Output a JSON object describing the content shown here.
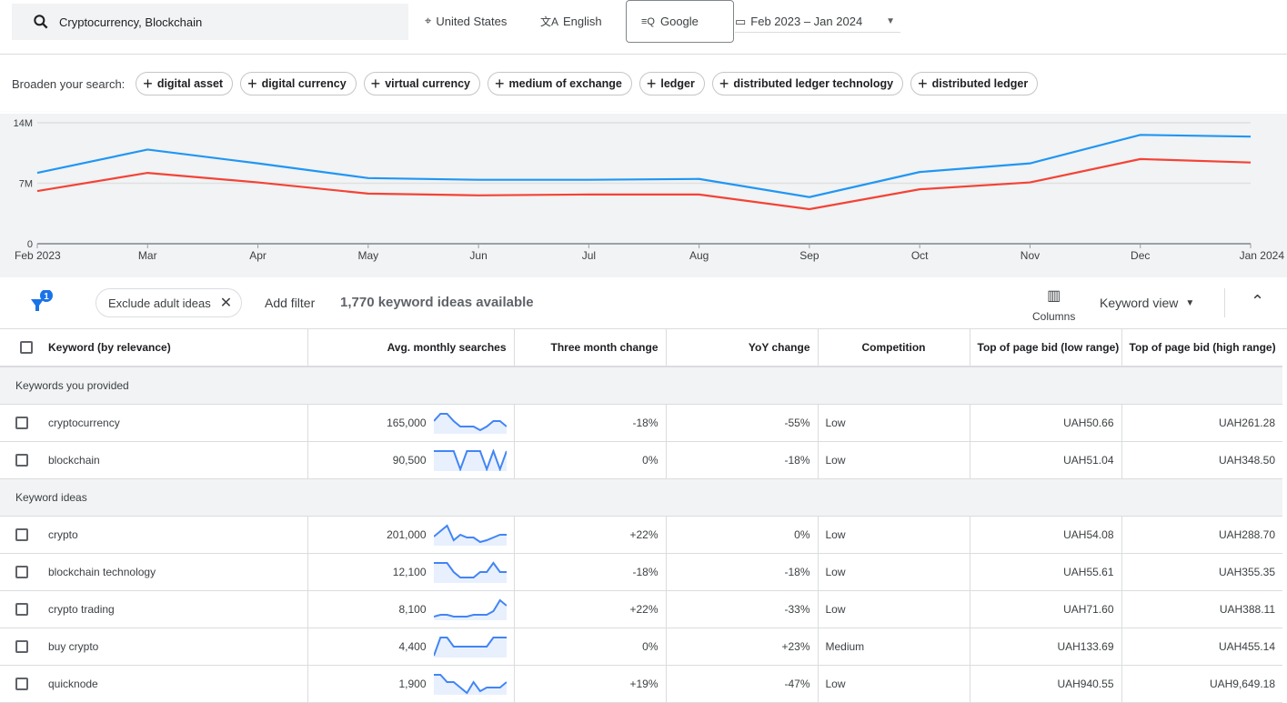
{
  "header": {
    "search_value": "Cryptocurrency, Blockchain",
    "location": "United States",
    "language": "English",
    "network": "Google",
    "date_range": "Feb 2023 – Jan 2024"
  },
  "broaden": {
    "label": "Broaden your search:",
    "chips": [
      "digital asset",
      "digital currency",
      "virtual currency",
      "medium of exchange",
      "ledger",
      "distributed ledger technology",
      "distributed ledger"
    ]
  },
  "colors": {
    "blue": "#2196f3",
    "red": "#f44336",
    "spark": "#4285f4",
    "accent": "#1a73e8"
  },
  "chart_data": {
    "type": "line",
    "categories": [
      "Feb 2023",
      "Mar",
      "Apr",
      "May",
      "Jun",
      "Jul",
      "Aug",
      "Sep",
      "Oct",
      "Nov",
      "Dec",
      "Jan 2024"
    ],
    "y_ticks": [
      "0",
      "7M",
      "14M"
    ],
    "ylim": [
      0,
      14000000
    ],
    "grid": true,
    "series": [
      {
        "color": "#2196f3",
        "values": [
          8200000,
          10900000,
          9300000,
          7600000,
          7400000,
          7400000,
          7500000,
          5400000,
          8300000,
          9300000,
          12600000,
          12400000
        ]
      },
      {
        "color": "#f44336",
        "values": [
          6100000,
          8200000,
          7100000,
          5800000,
          5600000,
          5700000,
          5700000,
          4000000,
          6300000,
          7100000,
          9800000,
          9400000
        ]
      }
    ]
  },
  "filterbar": {
    "filter_count": "1",
    "exclude_chip": "Exclude adult ideas",
    "add_filter": "Add filter",
    "ideas_count": "1,770 keyword ideas available",
    "columns": "Columns",
    "view": "Keyword view"
  },
  "table": {
    "headers": [
      "Keyword (by relevance)",
      "Avg. monthly searches",
      "Three month change",
      "YoY change",
      "Competition",
      "Top of page bid (low range)",
      "Top of page bid (high range)"
    ],
    "groups": [
      {
        "label": "Keywords you provided",
        "rows": [
          {
            "keyword": "cryptocurrency",
            "searches": "165,000",
            "three": "-18%",
            "yoy": "-55%",
            "competition": "Low",
            "low": "UAH50.66",
            "high": "UAH261.28",
            "trend": [
              0.6,
              1,
              1,
              0.6,
              0.3,
              0.3,
              0.3,
              0.1,
              0.3,
              0.6,
              0.6,
              0.3
            ]
          },
          {
            "keyword": "blockchain",
            "searches": "90,500",
            "three": "0%",
            "yoy": "-18%",
            "competition": "Low",
            "low": "UAH51.04",
            "high": "UAH348.50",
            "trend": [
              1,
              1,
              1,
              1,
              0,
              1,
              1,
              1,
              0,
              1,
              0,
              1
            ]
          }
        ]
      },
      {
        "label": "Keyword ideas",
        "rows": [
          {
            "keyword": "crypto",
            "searches": "201,000",
            "three": "+22%",
            "yoy": "0%",
            "competition": "Low",
            "low": "UAH54.08",
            "high": "UAH288.70",
            "trend": [
              0.4,
              0.7,
              1,
              0.2,
              0.5,
              0.35,
              0.35,
              0.1,
              0.2,
              0.35,
              0.5,
              0.5
            ]
          },
          {
            "keyword": "blockchain technology",
            "searches": "12,100",
            "three": "-18%",
            "yoy": "-18%",
            "competition": "Low",
            "low": "UAH55.61",
            "high": "UAH355.35",
            "trend": [
              1,
              1,
              1,
              0.5,
              0.2,
              0.2,
              0.2,
              0.5,
              0.5,
              1,
              0.5,
              0.5
            ]
          },
          {
            "keyword": "crypto trading",
            "searches": "8,100",
            "three": "+22%",
            "yoy": "-33%",
            "competition": "Low",
            "low": "UAH71.60",
            "high": "UAH388.11",
            "trend": [
              0.1,
              0.2,
              0.2,
              0.1,
              0.1,
              0.1,
              0.2,
              0.2,
              0.2,
              0.4,
              1,
              0.7
            ]
          },
          {
            "keyword": "buy crypto",
            "searches": "4,400",
            "three": "0%",
            "yoy": "+23%",
            "competition": "Medium",
            "low": "UAH133.69",
            "high": "UAH455.14",
            "trend": [
              0,
              1,
              1,
              0.5,
              0.5,
              0.5,
              0.5,
              0.5,
              0.5,
              1,
              1,
              1
            ]
          },
          {
            "keyword": "quicknode",
            "searches": "1,900",
            "three": "+19%",
            "yoy": "-47%",
            "competition": "Low",
            "low": "UAH940.55",
            "high": "UAH9,649.18",
            "trend": [
              1,
              1,
              0.6,
              0.6,
              0.3,
              0,
              0.6,
              0.1,
              0.3,
              0.3,
              0.3,
              0.6
            ]
          }
        ]
      }
    ]
  }
}
